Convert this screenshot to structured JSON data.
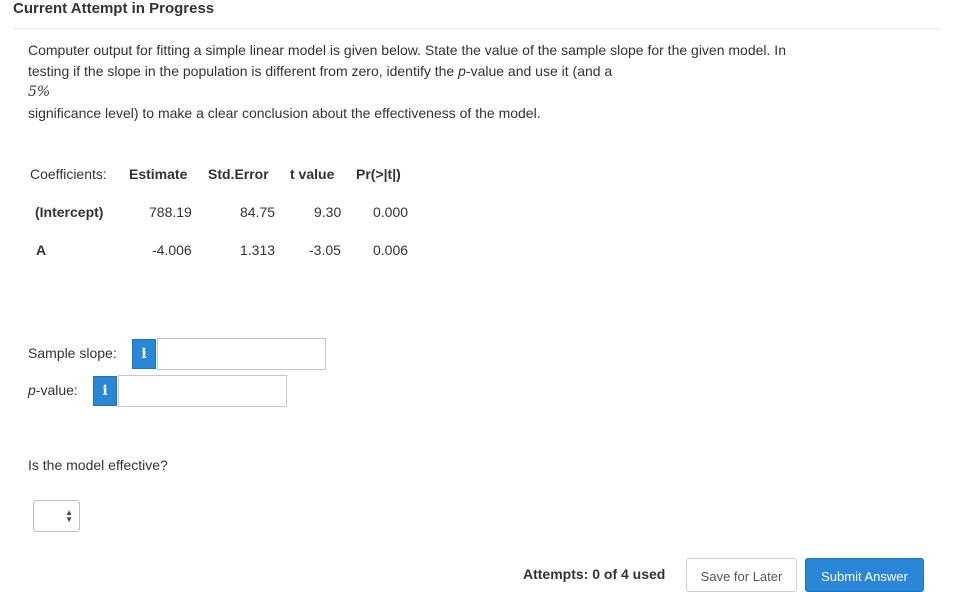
{
  "header": {
    "title": "Current Attempt in Progress"
  },
  "question": {
    "line1": "Computer output for fitting a simple linear model is given below. State the value of the sample slope for the given model. In",
    "line2_pre": "testing if the slope in the population is different from zero, identify the ",
    "line2_em": "p",
    "line2_post": "-value and use it (and a",
    "math": "5%",
    "line3": "significance level) to make a clear conclusion about the effectiveness of the model."
  },
  "coefficients": {
    "headers": [
      "Coefficients:",
      "Estimate",
      "Std.Error",
      "t value",
      "Pr(>|t|)"
    ],
    "rows": [
      {
        "name": "(Intercept)",
        "estimate": "788.19",
        "std_error": "84.75",
        "t_value": "9.30",
        "p": "0.000"
      },
      {
        "name": "A",
        "estimate": "-4.006",
        "std_error": "1.313",
        "t_value": "-3.05",
        "p": "0.006"
      }
    ]
  },
  "fields": {
    "slope_label": "Sample slope:",
    "pvalue_label_em": "p",
    "pvalue_label_post": "-value:",
    "info_glyph": "i",
    "slope_value": "",
    "pvalue_value": ""
  },
  "effective": {
    "question": "Is the model effective?",
    "selected": ""
  },
  "footer": {
    "attempts": "Attempts: 0 of 4 used",
    "save_label": "Save for Later",
    "submit_label": "Submit Answer"
  },
  "colors": {
    "accent": "#2a86d6",
    "border": "#c7c7c7"
  }
}
